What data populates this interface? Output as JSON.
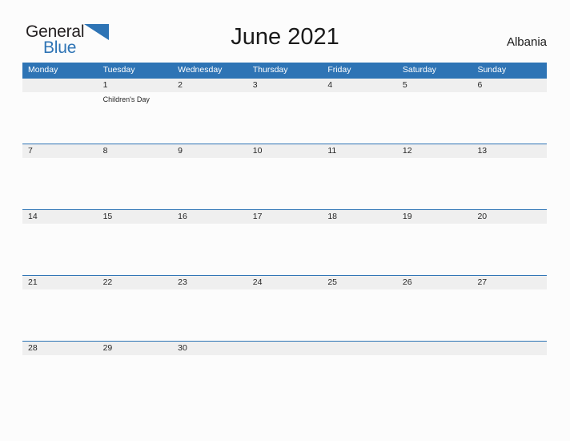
{
  "brand": {
    "name_part1": "General",
    "name_part2": "Blue",
    "flag_icon": "triangle-flag-icon",
    "color_dark": "#231f20",
    "color_blue": "#2e74b5"
  },
  "header": {
    "title": "June 2021",
    "country": "Albania"
  },
  "theme": {
    "header_blue": "#2e74b5",
    "date_band_gray": "#efefef",
    "page_background": "#fcfcfc",
    "text_dark": "#262626",
    "header_text": "#ffffff"
  },
  "calendar": {
    "month": "June",
    "year": "2021",
    "weekday_headers": [
      "Monday",
      "Tuesday",
      "Wednesday",
      "Thursday",
      "Friday",
      "Saturday",
      "Sunday"
    ],
    "weeks": [
      {
        "dates": [
          "",
          "1",
          "2",
          "3",
          "4",
          "5",
          "6"
        ],
        "events": [
          "",
          "Children's Day",
          "",
          "",
          "",
          "",
          ""
        ]
      },
      {
        "dates": [
          "7",
          "8",
          "9",
          "10",
          "11",
          "12",
          "13"
        ],
        "events": [
          "",
          "",
          "",
          "",
          "",
          "",
          ""
        ]
      },
      {
        "dates": [
          "14",
          "15",
          "16",
          "17",
          "18",
          "19",
          "20"
        ],
        "events": [
          "",
          "",
          "",
          "",
          "",
          "",
          ""
        ]
      },
      {
        "dates": [
          "21",
          "22",
          "23",
          "24",
          "25",
          "26",
          "27"
        ],
        "events": [
          "",
          "",
          "",
          "",
          "",
          "",
          ""
        ]
      },
      {
        "dates": [
          "28",
          "29",
          "30",
          "",
          "",
          "",
          ""
        ],
        "events": [
          "",
          "",
          "",
          "",
          "",
          "",
          ""
        ]
      }
    ]
  }
}
